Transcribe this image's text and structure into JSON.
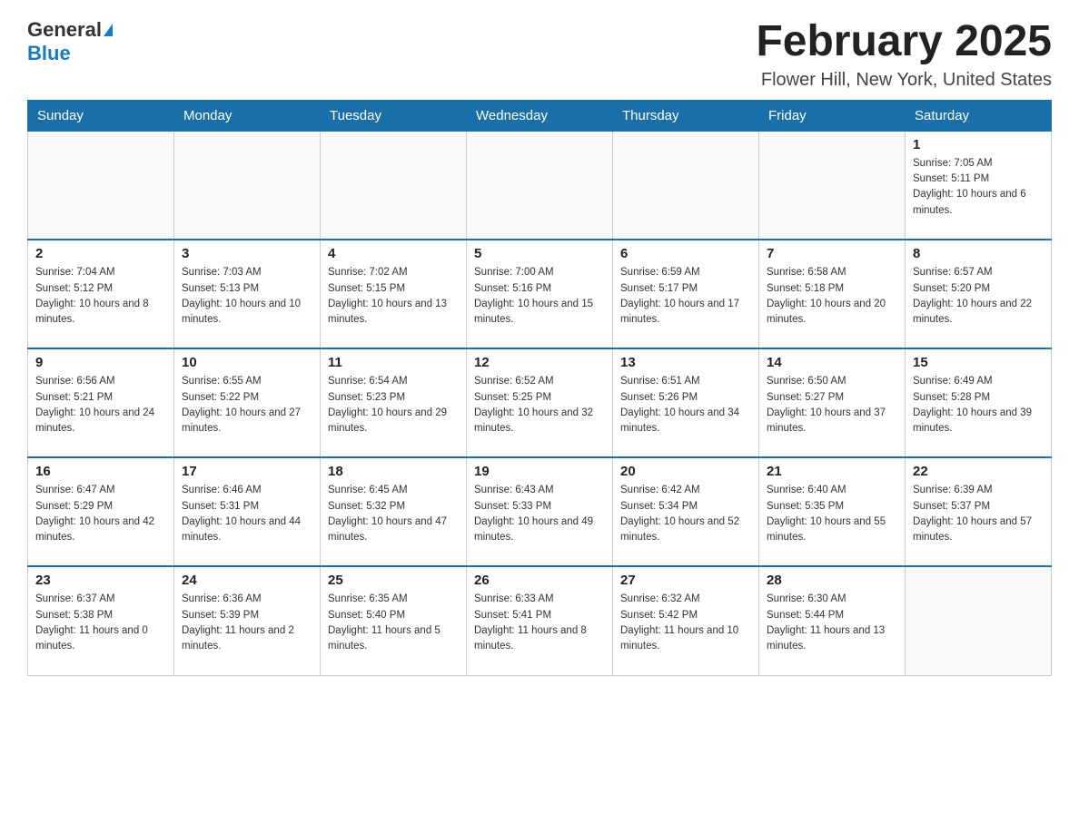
{
  "header": {
    "logo_general": "General",
    "logo_blue": "Blue",
    "title": "February 2025",
    "subtitle": "Flower Hill, New York, United States"
  },
  "weekdays": [
    "Sunday",
    "Monday",
    "Tuesday",
    "Wednesday",
    "Thursday",
    "Friday",
    "Saturday"
  ],
  "weeks": [
    [
      {
        "day": "",
        "sunrise": "",
        "sunset": "",
        "daylight": ""
      },
      {
        "day": "",
        "sunrise": "",
        "sunset": "",
        "daylight": ""
      },
      {
        "day": "",
        "sunrise": "",
        "sunset": "",
        "daylight": ""
      },
      {
        "day": "",
        "sunrise": "",
        "sunset": "",
        "daylight": ""
      },
      {
        "day": "",
        "sunrise": "",
        "sunset": "",
        "daylight": ""
      },
      {
        "day": "",
        "sunrise": "",
        "sunset": "",
        "daylight": ""
      },
      {
        "day": "1",
        "sunrise": "Sunrise: 7:05 AM",
        "sunset": "Sunset: 5:11 PM",
        "daylight": "Daylight: 10 hours and 6 minutes."
      }
    ],
    [
      {
        "day": "2",
        "sunrise": "Sunrise: 7:04 AM",
        "sunset": "Sunset: 5:12 PM",
        "daylight": "Daylight: 10 hours and 8 minutes."
      },
      {
        "day": "3",
        "sunrise": "Sunrise: 7:03 AM",
        "sunset": "Sunset: 5:13 PM",
        "daylight": "Daylight: 10 hours and 10 minutes."
      },
      {
        "day": "4",
        "sunrise": "Sunrise: 7:02 AM",
        "sunset": "Sunset: 5:15 PM",
        "daylight": "Daylight: 10 hours and 13 minutes."
      },
      {
        "day": "5",
        "sunrise": "Sunrise: 7:00 AM",
        "sunset": "Sunset: 5:16 PM",
        "daylight": "Daylight: 10 hours and 15 minutes."
      },
      {
        "day": "6",
        "sunrise": "Sunrise: 6:59 AM",
        "sunset": "Sunset: 5:17 PM",
        "daylight": "Daylight: 10 hours and 17 minutes."
      },
      {
        "day": "7",
        "sunrise": "Sunrise: 6:58 AM",
        "sunset": "Sunset: 5:18 PM",
        "daylight": "Daylight: 10 hours and 20 minutes."
      },
      {
        "day": "8",
        "sunrise": "Sunrise: 6:57 AM",
        "sunset": "Sunset: 5:20 PM",
        "daylight": "Daylight: 10 hours and 22 minutes."
      }
    ],
    [
      {
        "day": "9",
        "sunrise": "Sunrise: 6:56 AM",
        "sunset": "Sunset: 5:21 PM",
        "daylight": "Daylight: 10 hours and 24 minutes."
      },
      {
        "day": "10",
        "sunrise": "Sunrise: 6:55 AM",
        "sunset": "Sunset: 5:22 PM",
        "daylight": "Daylight: 10 hours and 27 minutes."
      },
      {
        "day": "11",
        "sunrise": "Sunrise: 6:54 AM",
        "sunset": "Sunset: 5:23 PM",
        "daylight": "Daylight: 10 hours and 29 minutes."
      },
      {
        "day": "12",
        "sunrise": "Sunrise: 6:52 AM",
        "sunset": "Sunset: 5:25 PM",
        "daylight": "Daylight: 10 hours and 32 minutes."
      },
      {
        "day": "13",
        "sunrise": "Sunrise: 6:51 AM",
        "sunset": "Sunset: 5:26 PM",
        "daylight": "Daylight: 10 hours and 34 minutes."
      },
      {
        "day": "14",
        "sunrise": "Sunrise: 6:50 AM",
        "sunset": "Sunset: 5:27 PM",
        "daylight": "Daylight: 10 hours and 37 minutes."
      },
      {
        "day": "15",
        "sunrise": "Sunrise: 6:49 AM",
        "sunset": "Sunset: 5:28 PM",
        "daylight": "Daylight: 10 hours and 39 minutes."
      }
    ],
    [
      {
        "day": "16",
        "sunrise": "Sunrise: 6:47 AM",
        "sunset": "Sunset: 5:29 PM",
        "daylight": "Daylight: 10 hours and 42 minutes."
      },
      {
        "day": "17",
        "sunrise": "Sunrise: 6:46 AM",
        "sunset": "Sunset: 5:31 PM",
        "daylight": "Daylight: 10 hours and 44 minutes."
      },
      {
        "day": "18",
        "sunrise": "Sunrise: 6:45 AM",
        "sunset": "Sunset: 5:32 PM",
        "daylight": "Daylight: 10 hours and 47 minutes."
      },
      {
        "day": "19",
        "sunrise": "Sunrise: 6:43 AM",
        "sunset": "Sunset: 5:33 PM",
        "daylight": "Daylight: 10 hours and 49 minutes."
      },
      {
        "day": "20",
        "sunrise": "Sunrise: 6:42 AM",
        "sunset": "Sunset: 5:34 PM",
        "daylight": "Daylight: 10 hours and 52 minutes."
      },
      {
        "day": "21",
        "sunrise": "Sunrise: 6:40 AM",
        "sunset": "Sunset: 5:35 PM",
        "daylight": "Daylight: 10 hours and 55 minutes."
      },
      {
        "day": "22",
        "sunrise": "Sunrise: 6:39 AM",
        "sunset": "Sunset: 5:37 PM",
        "daylight": "Daylight: 10 hours and 57 minutes."
      }
    ],
    [
      {
        "day": "23",
        "sunrise": "Sunrise: 6:37 AM",
        "sunset": "Sunset: 5:38 PM",
        "daylight": "Daylight: 11 hours and 0 minutes."
      },
      {
        "day": "24",
        "sunrise": "Sunrise: 6:36 AM",
        "sunset": "Sunset: 5:39 PM",
        "daylight": "Daylight: 11 hours and 2 minutes."
      },
      {
        "day": "25",
        "sunrise": "Sunrise: 6:35 AM",
        "sunset": "Sunset: 5:40 PM",
        "daylight": "Daylight: 11 hours and 5 minutes."
      },
      {
        "day": "26",
        "sunrise": "Sunrise: 6:33 AM",
        "sunset": "Sunset: 5:41 PM",
        "daylight": "Daylight: 11 hours and 8 minutes."
      },
      {
        "day": "27",
        "sunrise": "Sunrise: 6:32 AM",
        "sunset": "Sunset: 5:42 PM",
        "daylight": "Daylight: 11 hours and 10 minutes."
      },
      {
        "day": "28",
        "sunrise": "Sunrise: 6:30 AM",
        "sunset": "Sunset: 5:44 PM",
        "daylight": "Daylight: 11 hours and 13 minutes."
      },
      {
        "day": "",
        "sunrise": "",
        "sunset": "",
        "daylight": ""
      }
    ]
  ]
}
